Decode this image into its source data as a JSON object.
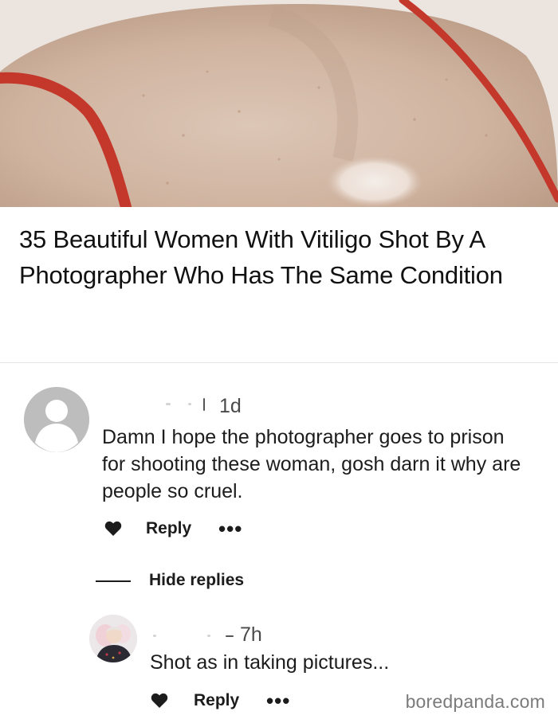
{
  "article": {
    "title": "35 Beautiful Women With Vitiligo Shot By A Photographer Who Has The Same Condition"
  },
  "comment": {
    "time": "1d",
    "text": "Damn I hope the photographer goes to prison for shooting these woman, gosh darn it why are people so cruel.",
    "reply_label": "Reply",
    "more_label": "•••",
    "like_icon": "heart-icon"
  },
  "thread": {
    "hide_replies_label": "Hide replies"
  },
  "reply": {
    "time": "7h",
    "text": "Shot as in taking pictures...",
    "reply_label": "Reply",
    "more_label": "•••",
    "like_icon": "heart-icon"
  },
  "watermark": "boredpanda.com",
  "colors": {
    "strap": "#c4372b",
    "skin": "#d2b8a5",
    "avatar_placeholder": "#bdbdbd"
  }
}
